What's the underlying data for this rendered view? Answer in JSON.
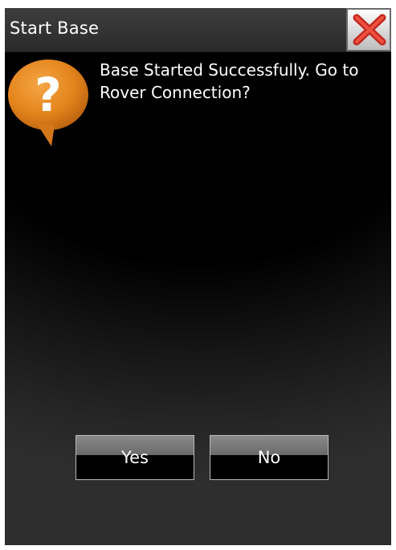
{
  "dialog": {
    "title": "Start Base",
    "message": "Base Started Successfully. Go to Rover Connection?",
    "icons": {
      "close": "close-icon",
      "question": "question-icon"
    }
  },
  "buttons": {
    "yes_label": "Yes",
    "no_label": "No"
  },
  "colors": {
    "background": "#000000",
    "title_bar": "#333333",
    "question_icon": "#e8891d",
    "close_x": "#d83a2c",
    "text": "#ffffff"
  }
}
